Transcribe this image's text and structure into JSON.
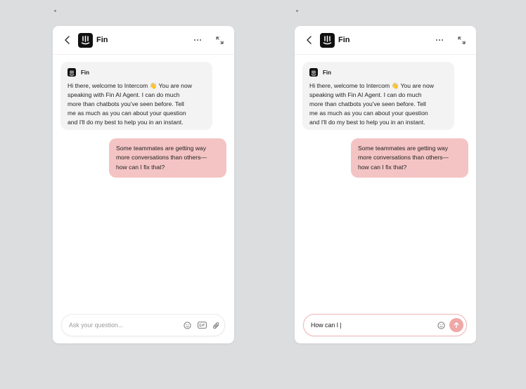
{
  "left_panel": {
    "header": {
      "title": "Fin"
    },
    "bot_message": {
      "sender": "Fin",
      "text": "Hi there, welcome to Intercom 👋 You are now\nspeaking with Fin AI Agent. I can do much\nmore than chatbots you've seen before. Tell\nme as much as you can about your question\nand I'll do my best to help you in an instant."
    },
    "user_message": {
      "text": "Some teammates are getting way\nmore conversations than others—\nhow can I fix that?"
    },
    "composer": {
      "placeholder": "Ask your question...",
      "value": ""
    }
  },
  "right_panel": {
    "header": {
      "title": "Fin"
    },
    "bot_message": {
      "sender": "Fin",
      "text": "Hi there, welcome to Intercom 👋 You are now\nspeaking with Fin AI Agent. I can do much\nmore than chatbots you've seen before. Tell\nme as much as you can about your question\nand I'll do my best to help you in an instant."
    },
    "user_message": {
      "text": "Some teammates are getting way\nmore conversations than others—\nhow can I fix that?"
    },
    "composer": {
      "placeholder": "",
      "value": "How can I |"
    }
  },
  "colors": {
    "background": "#dcdddf",
    "user_bubble": "#f4c4c4",
    "bot_bubble": "#f3f3f3",
    "send_button": "#efa7a7",
    "active_border": "#efb6b6"
  },
  "icons": [
    "back-icon",
    "intercom-logo",
    "more-icon",
    "expand-icon",
    "emoji-icon",
    "gif-icon",
    "attach-icon",
    "send-arrow-icon"
  ]
}
